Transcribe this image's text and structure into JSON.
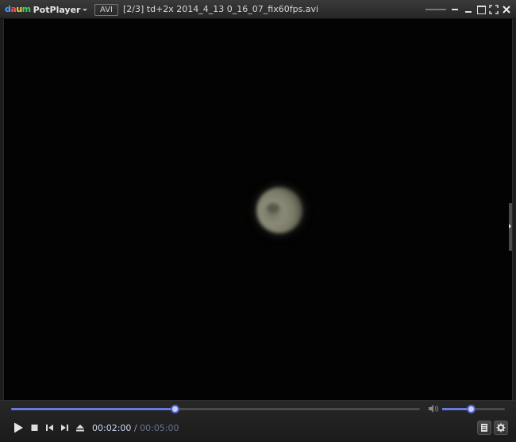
{
  "app": {
    "logo_badge": "daum",
    "name": "PotPlayer"
  },
  "titlebar": {
    "format_badge": "AVI",
    "title": "[2/3] td+2x 2014_4_13 0_16_07_fix60fps.avi"
  },
  "playback": {
    "current_time": "00:02:00",
    "separator": " / ",
    "total_time": "00:05:00",
    "progress_fraction": 0.4,
    "volume_fraction": 0.46
  },
  "colors": {
    "accent": "#6a78e0",
    "knob": "#c6d0ff",
    "video_bg": "#020302"
  },
  "icons": {
    "window": [
      "minimize-icon",
      "mini-mode-icon",
      "maximize-icon",
      "fullscreen-icon",
      "close-icon"
    ],
    "transport": [
      "play-icon",
      "stop-icon",
      "previous-icon",
      "next-icon",
      "eject-icon"
    ],
    "right": [
      "playlist-icon",
      "settings-icon"
    ],
    "volume": "speaker-icon"
  }
}
